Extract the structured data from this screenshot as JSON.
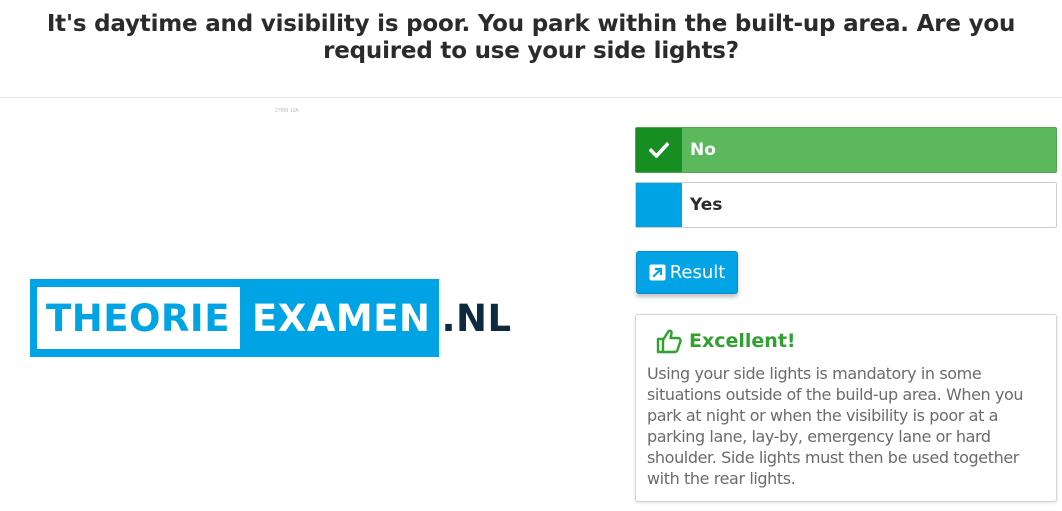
{
  "question": {
    "text": "It's daytime and visibility is poor. You park within the built-up area. Are you required to use your side lights?"
  },
  "image": {
    "caption": "27RM 12A"
  },
  "logo": {
    "part1": "THEORIE",
    "part2": "EXAMEN",
    "tld": ".NL"
  },
  "answers": [
    {
      "label": "No",
      "state": "correct-selected",
      "icon": "check-icon"
    },
    {
      "label": "Yes",
      "state": "unselected",
      "icon": ""
    }
  ],
  "result_button": {
    "label": "Result",
    "icon": "external-link-icon"
  },
  "feedback": {
    "icon": "thumbs-up-icon",
    "title": "Excellent!",
    "body": "Using your side lights is mandatory in some situations outside of the build-up area. When you park at night or when the visibility is poor at a parking lane, lay-by, emergency lane or hard shoulder. Side lights must then be used together with the rear lights."
  },
  "colors": {
    "correct": "#5cb85c",
    "correct_marker": "#178e21",
    "accent_blue": "#00a3e4",
    "feedback_title": "#2ea12e"
  }
}
